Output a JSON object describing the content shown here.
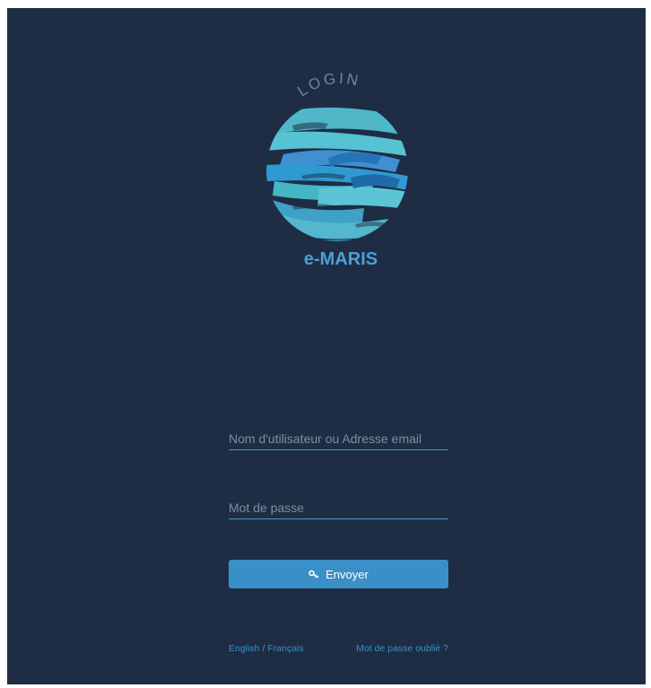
{
  "brand": {
    "arc_text": "LOGIN",
    "name": "e-MARIS",
    "logo_icon": "fish-globe-logo",
    "colors": {
      "background": "#1e2d44",
      "accent": "#3a8fc6",
      "brand_text": "#4c9fd6"
    }
  },
  "form": {
    "username_placeholder": "Nom d'utilisateur ou Adresse email",
    "password_placeholder": "Mot de passe",
    "submit_label": "Envoyer",
    "submit_icon": "key-icon"
  },
  "footer": {
    "lang_english": "English",
    "lang_separator": "/",
    "lang_french": "Français",
    "forgot_password": "Mot de passe oublié ?"
  }
}
